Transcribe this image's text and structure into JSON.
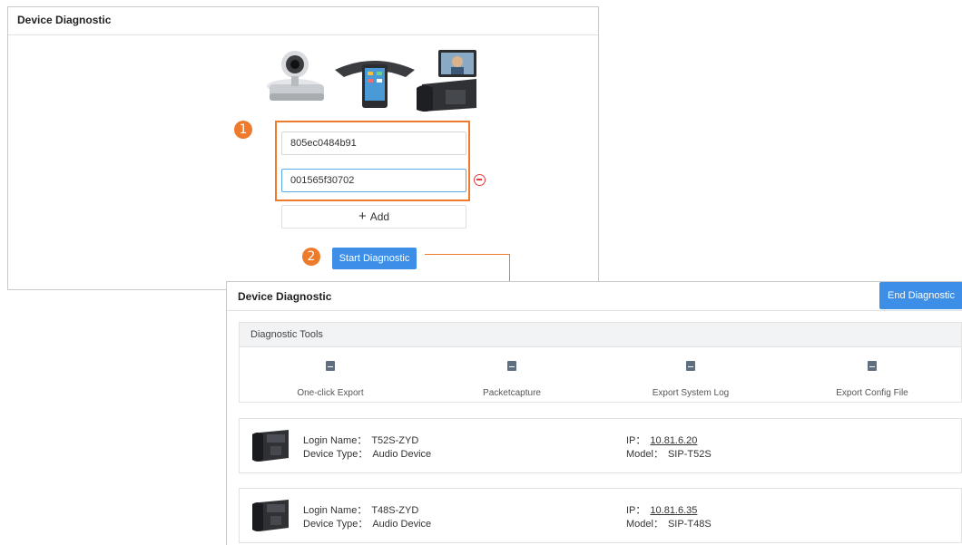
{
  "panel1": {
    "title": "Device Diagnostic",
    "steps": [
      "1",
      "2"
    ],
    "mac_inputs": [
      "805ec0484b91",
      "001565f30702"
    ],
    "add_label": "Add",
    "start_label": "Start Diagnostic"
  },
  "panel2": {
    "title": "Device Diagnostic",
    "end_label": "End Diagnostic",
    "tools_heading": "Diagnostic Tools",
    "tools": [
      {
        "label": "One-click Export",
        "icon": "export-icon"
      },
      {
        "label": "Packetcapture",
        "icon": "packet-icon"
      },
      {
        "label": "Export System Log",
        "icon": "log-icon"
      },
      {
        "label": "Export Config File",
        "icon": "config-file-icon"
      }
    ],
    "devices": [
      {
        "login_label": "Login Name：",
        "login": "T52S-ZYD",
        "type_label": "Device Type：",
        "type": "Audio Device",
        "ip_label": "IP：",
        "ip": "10.81.6.20",
        "model_label": "Model：",
        "model": "SIP-T52S"
      },
      {
        "login_label": "Login Name：",
        "login": "T48S-ZYD",
        "type_label": "Device Type：",
        "type": "Audio Device",
        "ip_label": "IP：",
        "ip": "10.81.6.35",
        "model_label": "Model：",
        "model": "SIP-T48S"
      }
    ]
  },
  "colors": {
    "accent": "#3d8ee6",
    "highlight": "#ee7a2c",
    "remove": "#e63c3c"
  }
}
